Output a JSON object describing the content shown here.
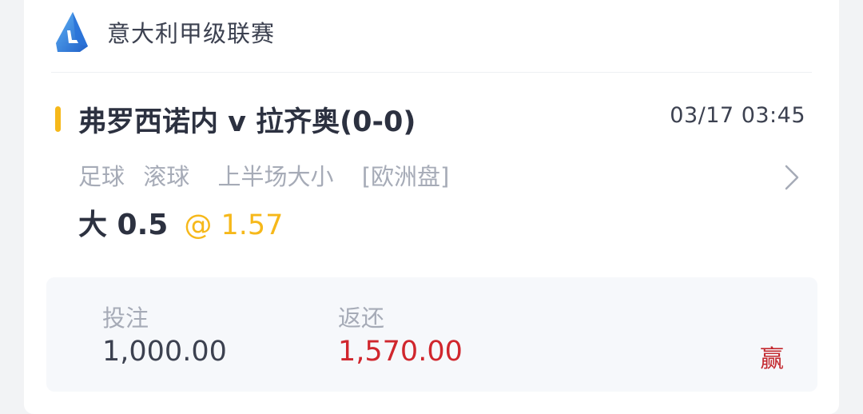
{
  "league": {
    "name": "意大利甲级联赛",
    "logo_icon": "serie-a-logo-icon"
  },
  "match": {
    "title": "弗罗西诺内 v 拉齐奥(0-0)",
    "time": "03/17 03:45"
  },
  "bet": {
    "sport": "足球",
    "mode": "滚球",
    "market": "上半场大小",
    "odds_format": "[欧洲盘]",
    "selection": "大 0.5",
    "odds": "@ 1.57"
  },
  "stake": {
    "stake_label": "投注",
    "stake_value": "1,000.00",
    "return_label": "返还",
    "return_value": "1,570.00",
    "result": "赢"
  },
  "colors": {
    "accent": "#f6b81a",
    "win_red": "#d0262d"
  }
}
